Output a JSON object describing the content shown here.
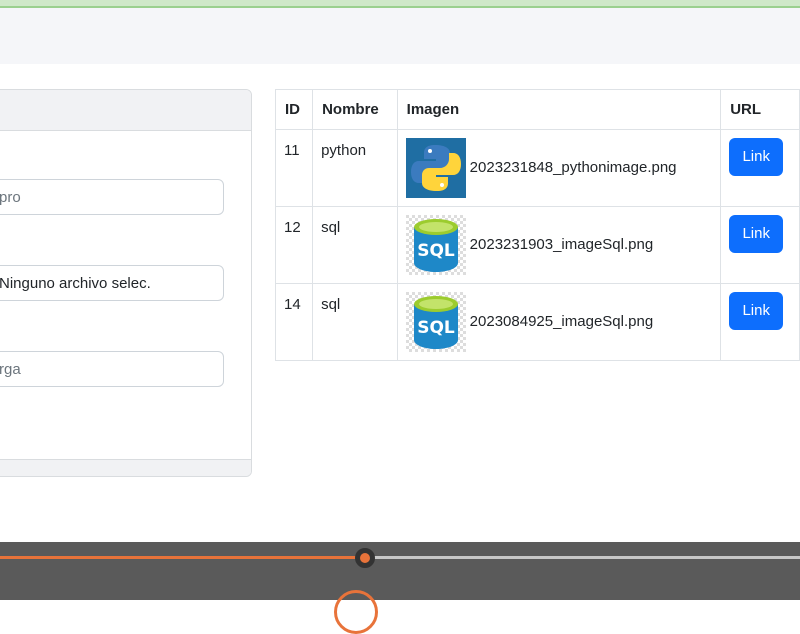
{
  "form": {
    "field1_placeholder": "pro",
    "file_label": "Ninguno archivo selec.",
    "field3_placeholder": "rga"
  },
  "table": {
    "headers": [
      "ID",
      "Nombre",
      "Imagen",
      "URL"
    ],
    "rows": [
      {
        "id": "11",
        "name": "python",
        "icon": "python-logo-icon",
        "filename": "2023231848_pythonimage.png",
        "link": "Link"
      },
      {
        "id": "12",
        "name": "sql",
        "icon": "sql-database-icon",
        "filename": "2023231903_imageSql.png",
        "link": "Link"
      },
      {
        "id": "14",
        "name": "sql",
        "icon": "sql-database-icon",
        "filename": "2023084925_imageSql.png",
        "link": "Link"
      }
    ]
  },
  "player": {
    "progress": 0.456,
    "colors": {
      "accent": "#e8733a",
      "bar_bg": "#5a5a5a"
    }
  },
  "colors": {
    "primary_button": "#0d6efd",
    "navbar_bg": "#f5f6f9"
  }
}
